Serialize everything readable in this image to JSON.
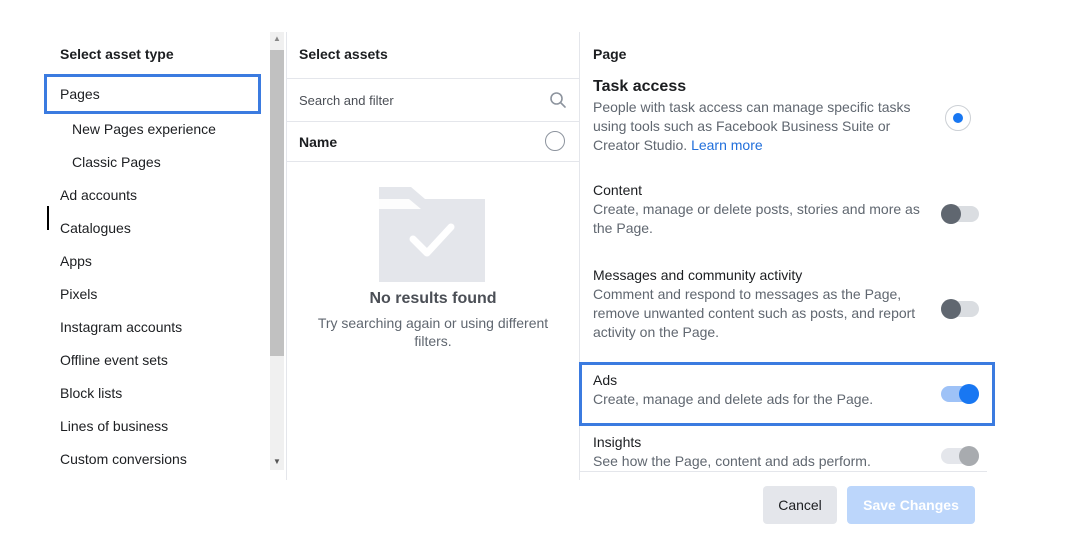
{
  "left_panel": {
    "title": "Select asset type",
    "items": [
      {
        "label": "Pages",
        "selected": true
      },
      {
        "label": "New Pages experience",
        "sub": true
      },
      {
        "label": "Classic Pages",
        "sub": true
      },
      {
        "label": "Ad accounts"
      },
      {
        "label": "Catalogues"
      },
      {
        "label": "Apps"
      },
      {
        "label": "Pixels"
      },
      {
        "label": "Instagram accounts"
      },
      {
        "label": "Offline event sets"
      },
      {
        "label": "Block lists"
      },
      {
        "label": "Lines of business"
      },
      {
        "label": "Custom conversions"
      }
    ]
  },
  "middle_panel": {
    "title": "Select assets",
    "search_placeholder": "Search and filter",
    "column_header": "Name",
    "empty_title": "No results found",
    "empty_subtitle": "Try searching again or using different filters."
  },
  "right_panel": {
    "title": "Page",
    "task_access": {
      "heading": "Task access",
      "description": "People with task access can manage specific tasks using tools such as Facebook Business Suite or Creator Studio.",
      "link": "Learn more",
      "selected": true
    },
    "permissions": [
      {
        "heading": "Content",
        "description": "Create, manage or delete posts, stories and more as the Page.",
        "enabled": false
      },
      {
        "heading": "Messages and community activity",
        "description": "Comment and respond to messages as the Page, remove unwanted content such as posts, and report activity on the Page.",
        "enabled": false
      },
      {
        "heading": "Ads",
        "description": "Create, manage and delete ads for the Page.",
        "enabled": true
      },
      {
        "heading": "Insights",
        "description": "See how the Page, content and ads perform.",
        "enabled": true,
        "locked": true
      }
    ]
  },
  "footer": {
    "cancel_label": "Cancel",
    "save_label": "Save Changes"
  },
  "colors": {
    "accent": "#1877f2",
    "highlight": "#3b7be0",
    "save_disabled": "#bcd6fb"
  }
}
